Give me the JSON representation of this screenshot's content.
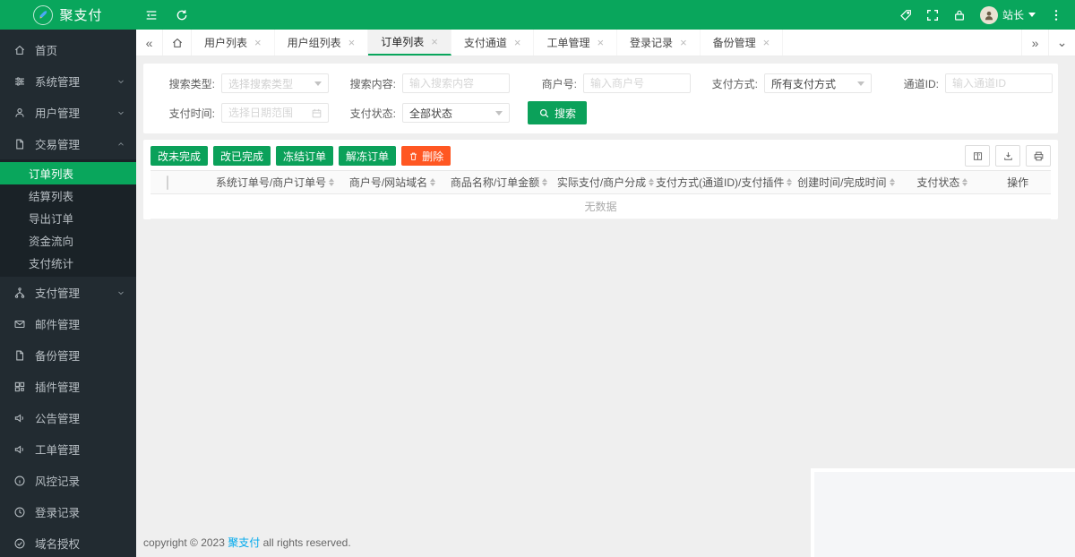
{
  "colors": {
    "primary_green": "#09a65c",
    "button_green": "#0ba15a",
    "danger_red": "#ff5722",
    "link_blue": "#01aaed",
    "sidebar_bg": "#222b31"
  },
  "brand": "聚支付",
  "header": {
    "user_name": "站长"
  },
  "sidebar": {
    "items": [
      {
        "label": "首页"
      },
      {
        "label": "系统管理"
      },
      {
        "label": "用户管理"
      },
      {
        "label": "交易管理"
      },
      {
        "label": "支付管理"
      },
      {
        "label": "邮件管理"
      },
      {
        "label": "备份管理"
      },
      {
        "label": "插件管理"
      },
      {
        "label": "公告管理"
      },
      {
        "label": "工单管理"
      },
      {
        "label": "风控记录"
      },
      {
        "label": "登录记录"
      },
      {
        "label": "域名授权"
      }
    ],
    "trade_children": [
      {
        "label": "订单列表"
      },
      {
        "label": "结算列表"
      },
      {
        "label": "导出订单"
      },
      {
        "label": "资金流向"
      },
      {
        "label": "支付统计"
      }
    ],
    "active_child": "订单列表"
  },
  "tabs": [
    "用户列表",
    "用户组列表",
    "订单列表",
    "支付通道",
    "工单管理",
    "登录记录",
    "备份管理"
  ],
  "active_tab": "订单列表",
  "filters": {
    "search_type": {
      "label": "搜索类型:",
      "value": "选择搜索类型"
    },
    "search_content": {
      "label": "搜索内容:",
      "placeholder": "输入搜索内容"
    },
    "merchant": {
      "label": "商户号:",
      "placeholder": "输入商户号"
    },
    "pay_method": {
      "label": "支付方式:",
      "value": "所有支付方式"
    },
    "channel": {
      "label": "通道ID:",
      "placeholder": "输入通道ID"
    },
    "pay_time": {
      "label": "支付时间:",
      "placeholder": "选择日期范围"
    },
    "pay_status": {
      "label": "支付状态:",
      "value": "全部状态"
    },
    "search_btn": "搜索"
  },
  "toolbar": {
    "actions": [
      {
        "label": "改未完成",
        "type": "green"
      },
      {
        "label": "改已完成",
        "type": "green"
      },
      {
        "label": "冻结订单",
        "type": "green"
      },
      {
        "label": "解冻订单",
        "type": "green"
      },
      {
        "label": "删除",
        "type": "red"
      }
    ]
  },
  "table": {
    "columns": [
      "系统订单号/商户订单号",
      "商户号/网站域名",
      "商品名称/订单金额",
      "实际支付/商户分成",
      "支付方式(通道ID)/支付插件",
      "创建时间/完成时间",
      "支付状态",
      "操作"
    ],
    "empty_text": "无数据"
  },
  "footer": {
    "text_before": "copyright © 2023",
    "brand": "聚支付",
    "text_after": "all rights reserved."
  }
}
